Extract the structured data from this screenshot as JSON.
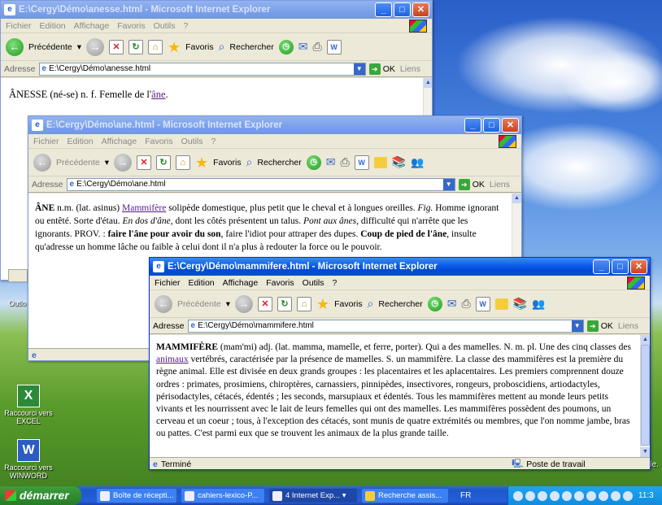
{
  "window1": {
    "title": "E:\\Cergy\\Démo\\anesse.html - Microsoft Internet Explorer",
    "menu": [
      "Fichier",
      "Edition",
      "Affichage",
      "Favoris",
      "Outils",
      "?"
    ],
    "toolbar": {
      "back": "Précédente",
      "favorites": "Favoris",
      "search": "Rechercher"
    },
    "address_label": "Adresse",
    "address": "E:\\Cergy\\Démo\\anesse.html",
    "ok": "OK",
    "links": "Liens",
    "content": {
      "head": "ÂNESSE",
      "pre": " (né-se) n. f. Femelle de l'",
      "link": "âne",
      "post": "."
    }
  },
  "window2": {
    "title": "E:\\Cergy\\Démo\\ane.html - Microsoft Internet Explorer",
    "menu": [
      "Fichier",
      "Edition",
      "Affichage",
      "Favoris",
      "Outils",
      "?"
    ],
    "toolbar": {
      "back": "Précédente",
      "favorites": "Favoris",
      "search": "Rechercher"
    },
    "address_label": "Adresse",
    "address": "E:\\Cergy\\Démo\\ane.html",
    "ok": "OK",
    "links": "Liens",
    "content": {
      "head": "ÂNE",
      "t1": " n.m. (lat. asinus) ",
      "link": "Mammifère",
      "t2": " solipède domestique, plus petit que le cheval et à longues oreilles. ",
      "fig": "Fig.",
      "t3": " Homme ignorant ou entêté. Sorte d'étau. ",
      "i1": "En dos d'âne,",
      "t4": " dont les côtés présentent un talus. ",
      "i2": "Pont aux ânes,",
      "t5": " difficulté qui n'arrête que les ignorants. PROV. : ",
      "b1": "faire l'âne pour avoir du son",
      "t6": ", faire l'idiot pour attraper des dupes. ",
      "b2": "Coup de pied de l'âne",
      "t7": ", insulte qu'adresse un homme lâche ou faible à celui dont il n'a plus à redouter la force ou le pouvoir."
    }
  },
  "window3": {
    "title": "E:\\Cergy\\Démo\\mammifere.html - Microsoft Internet Explorer",
    "menu": [
      "Fichier",
      "Edition",
      "Affichage",
      "Favoris",
      "Outils",
      "?"
    ],
    "toolbar": {
      "back": "Précédente",
      "favorites": "Favoris",
      "search": "Rechercher"
    },
    "address_label": "Adresse",
    "address": "E:\\Cergy\\Démo\\mammifere.html",
    "ok": "OK",
    "links": "Liens",
    "content": {
      "head": "MAMMIFÈRE",
      "t1": " (mam'mi) adj. (lat. mamma, mamelle, et ferre, porter). Qui a des mamelles. N. m. pl. Une des cinq classes des ",
      "link": "animaux",
      "t2": " vertébrés, caractérisée par la présence de mamelles. S. un mammifère. La classe des mammifères est la première du règne animal. Elle est divisée en deux grands groupes : les placentaires et les aplacentaires. Les premiers comprennent douze ordres : primates, prosimiens, chiroptères, carnassiers, pinnipèdes, insectivores, rongeurs, proboscidiens, artiodactyles, périsodactyles, cétacés, édentés ; les seconds, marsupiaux et édentés. Tous les mammifères mettent au monde leurs petits vivants et les nourrissent avec le lait de leurs femelles qui ont des mamelles. Les mammifères possèdent des poumons, un cerveau et un coeur ; tous, à l'exception des cétacés, sont munis de quatre extrémités ou membres, que l'on nomme jambe, bras ou pattes. C'est parmi eux que se trouvent les animaux de la plus grande taille."
    },
    "status_left": "Terminé",
    "status_right": "Poste de travail"
  },
  "desktop": {
    "icon_excel": "Raccourci vers EXCEL",
    "icon_word": "Raccourci vers WINWORD",
    "outlook_partial": "Outlo",
    "edge_text": "lle."
  },
  "taskbar": {
    "start": "démarrer",
    "tasks": [
      "Boîte de récepti...",
      "cahiers-lexico-P...",
      "4 Internet Exp...",
      "Recherche assis..."
    ],
    "lang": "FR",
    "clock": "11:3"
  }
}
